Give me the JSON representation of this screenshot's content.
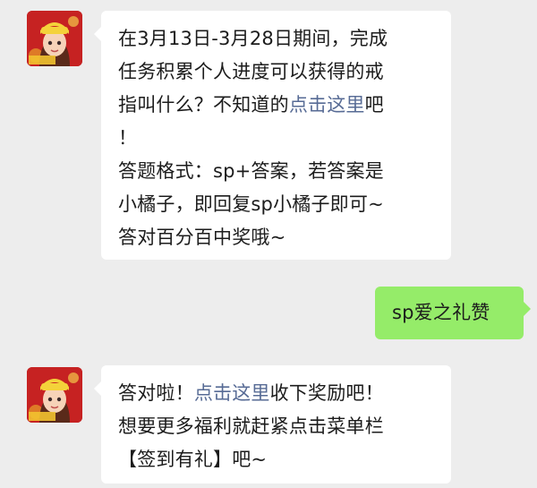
{
  "messages": [
    {
      "side": "left",
      "lines": [
        [
          {
            "t": "在3月13日-3月28日期间，完成"
          }
        ],
        [
          {
            "t": "任务积累个人进度可以获得的戒"
          }
        ],
        [
          {
            "t": "指叫什么？不知道的"
          },
          {
            "t": "点击这里",
            "link": true
          },
          {
            "t": "吧"
          }
        ],
        [
          {
            "t": "！"
          }
        ],
        [
          {
            "t": "答题格式：sp+答案，若答案是"
          }
        ],
        [
          {
            "t": "小橘子，即回复sp小橘子即可~"
          }
        ],
        [
          {
            "t": "答对百分百中奖哦~"
          }
        ]
      ]
    },
    {
      "side": "right",
      "lines": [
        [
          {
            "t": "sp爱之礼赞"
          }
        ]
      ]
    },
    {
      "side": "left",
      "lines": [
        [
          {
            "t": "答对啦！"
          },
          {
            "t": "点击这里",
            "link": true
          },
          {
            "t": "收下奖励吧！"
          }
        ],
        [
          {
            "t": "想要更多福利就赶紧点击菜单栏"
          }
        ],
        [
          {
            "t": "【签到有礼】吧~"
          }
        ]
      ]
    }
  ],
  "colors": {
    "background": "#ededed",
    "bubble_left": "#ffffff",
    "bubble_right": "#95ec69",
    "link": "#576b95"
  }
}
